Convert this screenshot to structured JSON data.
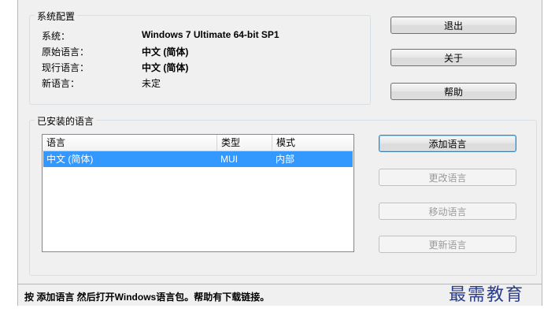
{
  "config": {
    "title": "系统配置",
    "rows": [
      {
        "label": "系统：",
        "value": "Windows 7 Ultimate 64-bit SP1"
      },
      {
        "label": "原始语言：",
        "value": "中文 (简体)"
      },
      {
        "label": "现行语言：",
        "value": "中文 (简体)"
      },
      {
        "label": "新语言：",
        "value": "未定"
      }
    ]
  },
  "buttons": {
    "exit": "退出",
    "about": "关于",
    "help": "帮助",
    "add_language": "添加语言",
    "change_language": "更改语言",
    "move_language": "移动语言",
    "update_language": "更新语言"
  },
  "installed": {
    "title": "已安装的语言",
    "columns": [
      "语言",
      "类型",
      "模式"
    ],
    "rows": [
      {
        "language": "中文 (简体)",
        "type": "MUI",
        "mode": "内部",
        "selected": true
      }
    ]
  },
  "status_bar": "按 添加语言 然后打开Windows语言包。帮助有下载链接。",
  "watermark": "最需教育",
  "colors": {
    "selection": "#3399ff",
    "watermark": "#2a3c8a"
  }
}
